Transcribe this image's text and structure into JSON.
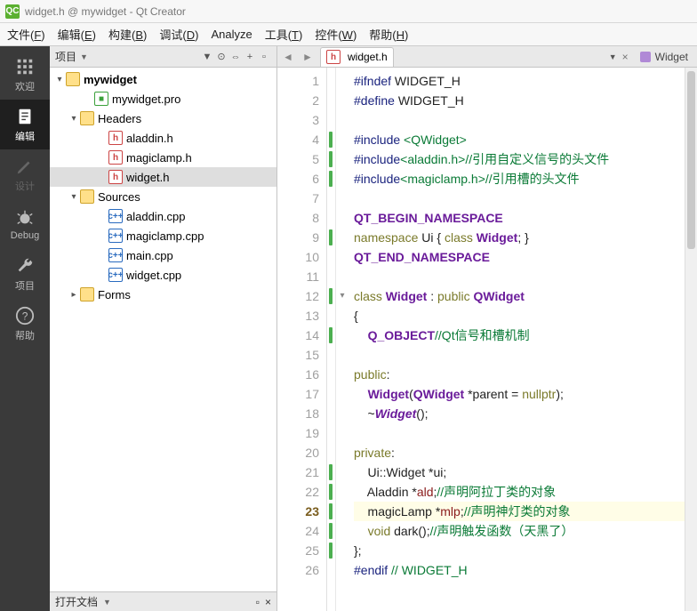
{
  "window": {
    "title": "widget.h @ mywidget - Qt Creator"
  },
  "menu": {
    "file": "文件(<u>F</u>)",
    "edit": "编辑(<u>E</u>)",
    "build": "构建(<u>B</u>)",
    "debug": "调试(<u>D</u>)",
    "analyze": "Analyze",
    "tools": "工具(<u>T</u>)",
    "widgets": "控件(<u>W</u>)",
    "help": "帮助(<u>H</u>)"
  },
  "modes": [
    {
      "id": "welcome",
      "label": "欢迎"
    },
    {
      "id": "edit",
      "label": "编辑"
    },
    {
      "id": "design",
      "label": "设计"
    },
    {
      "id": "debug",
      "label": "Debug"
    },
    {
      "id": "projects",
      "label": "项目"
    },
    {
      "id": "help",
      "label": "帮助"
    }
  ],
  "panel": {
    "title": "项目",
    "footer": "打开文档"
  },
  "tree": {
    "root": {
      "label": "mywidget",
      "icon": "folder",
      "expand": "▾",
      "bold": true,
      "indent": 0
    },
    "pro": {
      "label": "mywidget.pro",
      "icon": "pro",
      "indent": 2
    },
    "headers": {
      "label": "Headers",
      "icon": "folder",
      "expand": "▾",
      "indent": 1
    },
    "h1": {
      "label": "aladdin.h",
      "icon": "h",
      "indent": 3
    },
    "h2": {
      "label": "magiclamp.h",
      "icon": "h",
      "indent": 3
    },
    "h3": {
      "label": "widget.h",
      "icon": "h",
      "indent": 3,
      "sel": true
    },
    "sources": {
      "label": "Sources",
      "icon": "folder",
      "expand": "▾",
      "indent": 1
    },
    "c1": {
      "label": "aladdin.cpp",
      "icon": "cpp",
      "indent": 3
    },
    "c2": {
      "label": "magiclamp.cpp",
      "icon": "cpp",
      "indent": 3
    },
    "c3": {
      "label": "main.cpp",
      "icon": "cpp",
      "indent": 3
    },
    "c4": {
      "label": "widget.cpp",
      "icon": "cpp",
      "indent": 3
    },
    "forms": {
      "label": "Forms",
      "icon": "folder",
      "expand": "▸",
      "indent": 1
    }
  },
  "tabs": {
    "file": "widget.h",
    "context": "Widget"
  },
  "code": {
    "current_line": 23,
    "lines": [
      {
        "n": 1,
        "html": "<span class='pp'>#ifndef</span> WIDGET_H"
      },
      {
        "n": 2,
        "html": "<span class='pp'>#define</span> WIDGET_H"
      },
      {
        "n": 3,
        "html": ""
      },
      {
        "n": 4,
        "html": "<span class='pp'>#include</span> <span class='inc'>&lt;QWidget&gt;</span>",
        "mark": true
      },
      {
        "n": 5,
        "html": "<span class='pp'>#include</span><span class='inc'>&lt;aladdin.h&gt;</span><span class='cmt'>//引用自定义信号的头文件</span>",
        "mark": true
      },
      {
        "n": 6,
        "html": "<span class='pp'>#include</span><span class='inc'>&lt;magiclamp.h&gt;</span><span class='cmt'>//引用槽的头文件</span>",
        "mark": true
      },
      {
        "n": 7,
        "html": ""
      },
      {
        "n": 8,
        "html": "<span class='cls'>QT_BEGIN_NAMESPACE</span>"
      },
      {
        "n": 9,
        "html": "<span class='kw'>namespace</span> Ui { <span class='kw'>class</span> <span class='cls'>Widget</span>; }",
        "mark": true
      },
      {
        "n": 10,
        "html": "<span class='cls'>QT_END_NAMESPACE</span>"
      },
      {
        "n": 11,
        "html": ""
      },
      {
        "n": 12,
        "html": "<span class='kw'>class</span> <span class='cls'>Widget</span> : <span class='kw'>public</span> <span class='cls'>QWidget</span>",
        "fold": "▾",
        "mark": true
      },
      {
        "n": 13,
        "html": "{"
      },
      {
        "n": 14,
        "html": "    <span class='cls'>Q_OBJECT</span><span class='cmt'>//Qt信号和槽机制</span>",
        "mark": true
      },
      {
        "n": 15,
        "html": ""
      },
      {
        "n": 16,
        "html": "<span class='kw'>public</span>:"
      },
      {
        "n": 17,
        "html": "    <span class='cls'>Widget</span>(<span class='cls'>QWidget</span> *parent = <span class='kw'>nullptr</span>);"
      },
      {
        "n": 18,
        "html": "    ~<span class='cls' style='font-style:italic'>Widget</span>();"
      },
      {
        "n": 19,
        "html": ""
      },
      {
        "n": 20,
        "html": "<span class='kw'>private</span>:"
      },
      {
        "n": 21,
        "html": "    Ui::Widget *ui;",
        "mark": true
      },
      {
        "n": 22,
        "html": "    Aladdin *<span style='color:#8a1b1b'>ald</span>;<span class='cmt'>//声明阿拉丁类的对象</span>",
        "mark": true
      },
      {
        "n": 23,
        "html": "    magicLamp *<span style='color:#8a1b1b'>mlp</span>;<span class='cmt'>//声明神灯类的对象</span>",
        "mark": true
      },
      {
        "n": 24,
        "html": "    <span class='kw'>void</span> dark();<span class='cmt'>//声明触发函数（天黑了）</span>",
        "mark": true
      },
      {
        "n": 25,
        "html": "};",
        "mark": true
      },
      {
        "n": 26,
        "html": "<span class='pp'>#endif</span> <span class='cmt'>// WIDGET_H</span>"
      }
    ]
  }
}
